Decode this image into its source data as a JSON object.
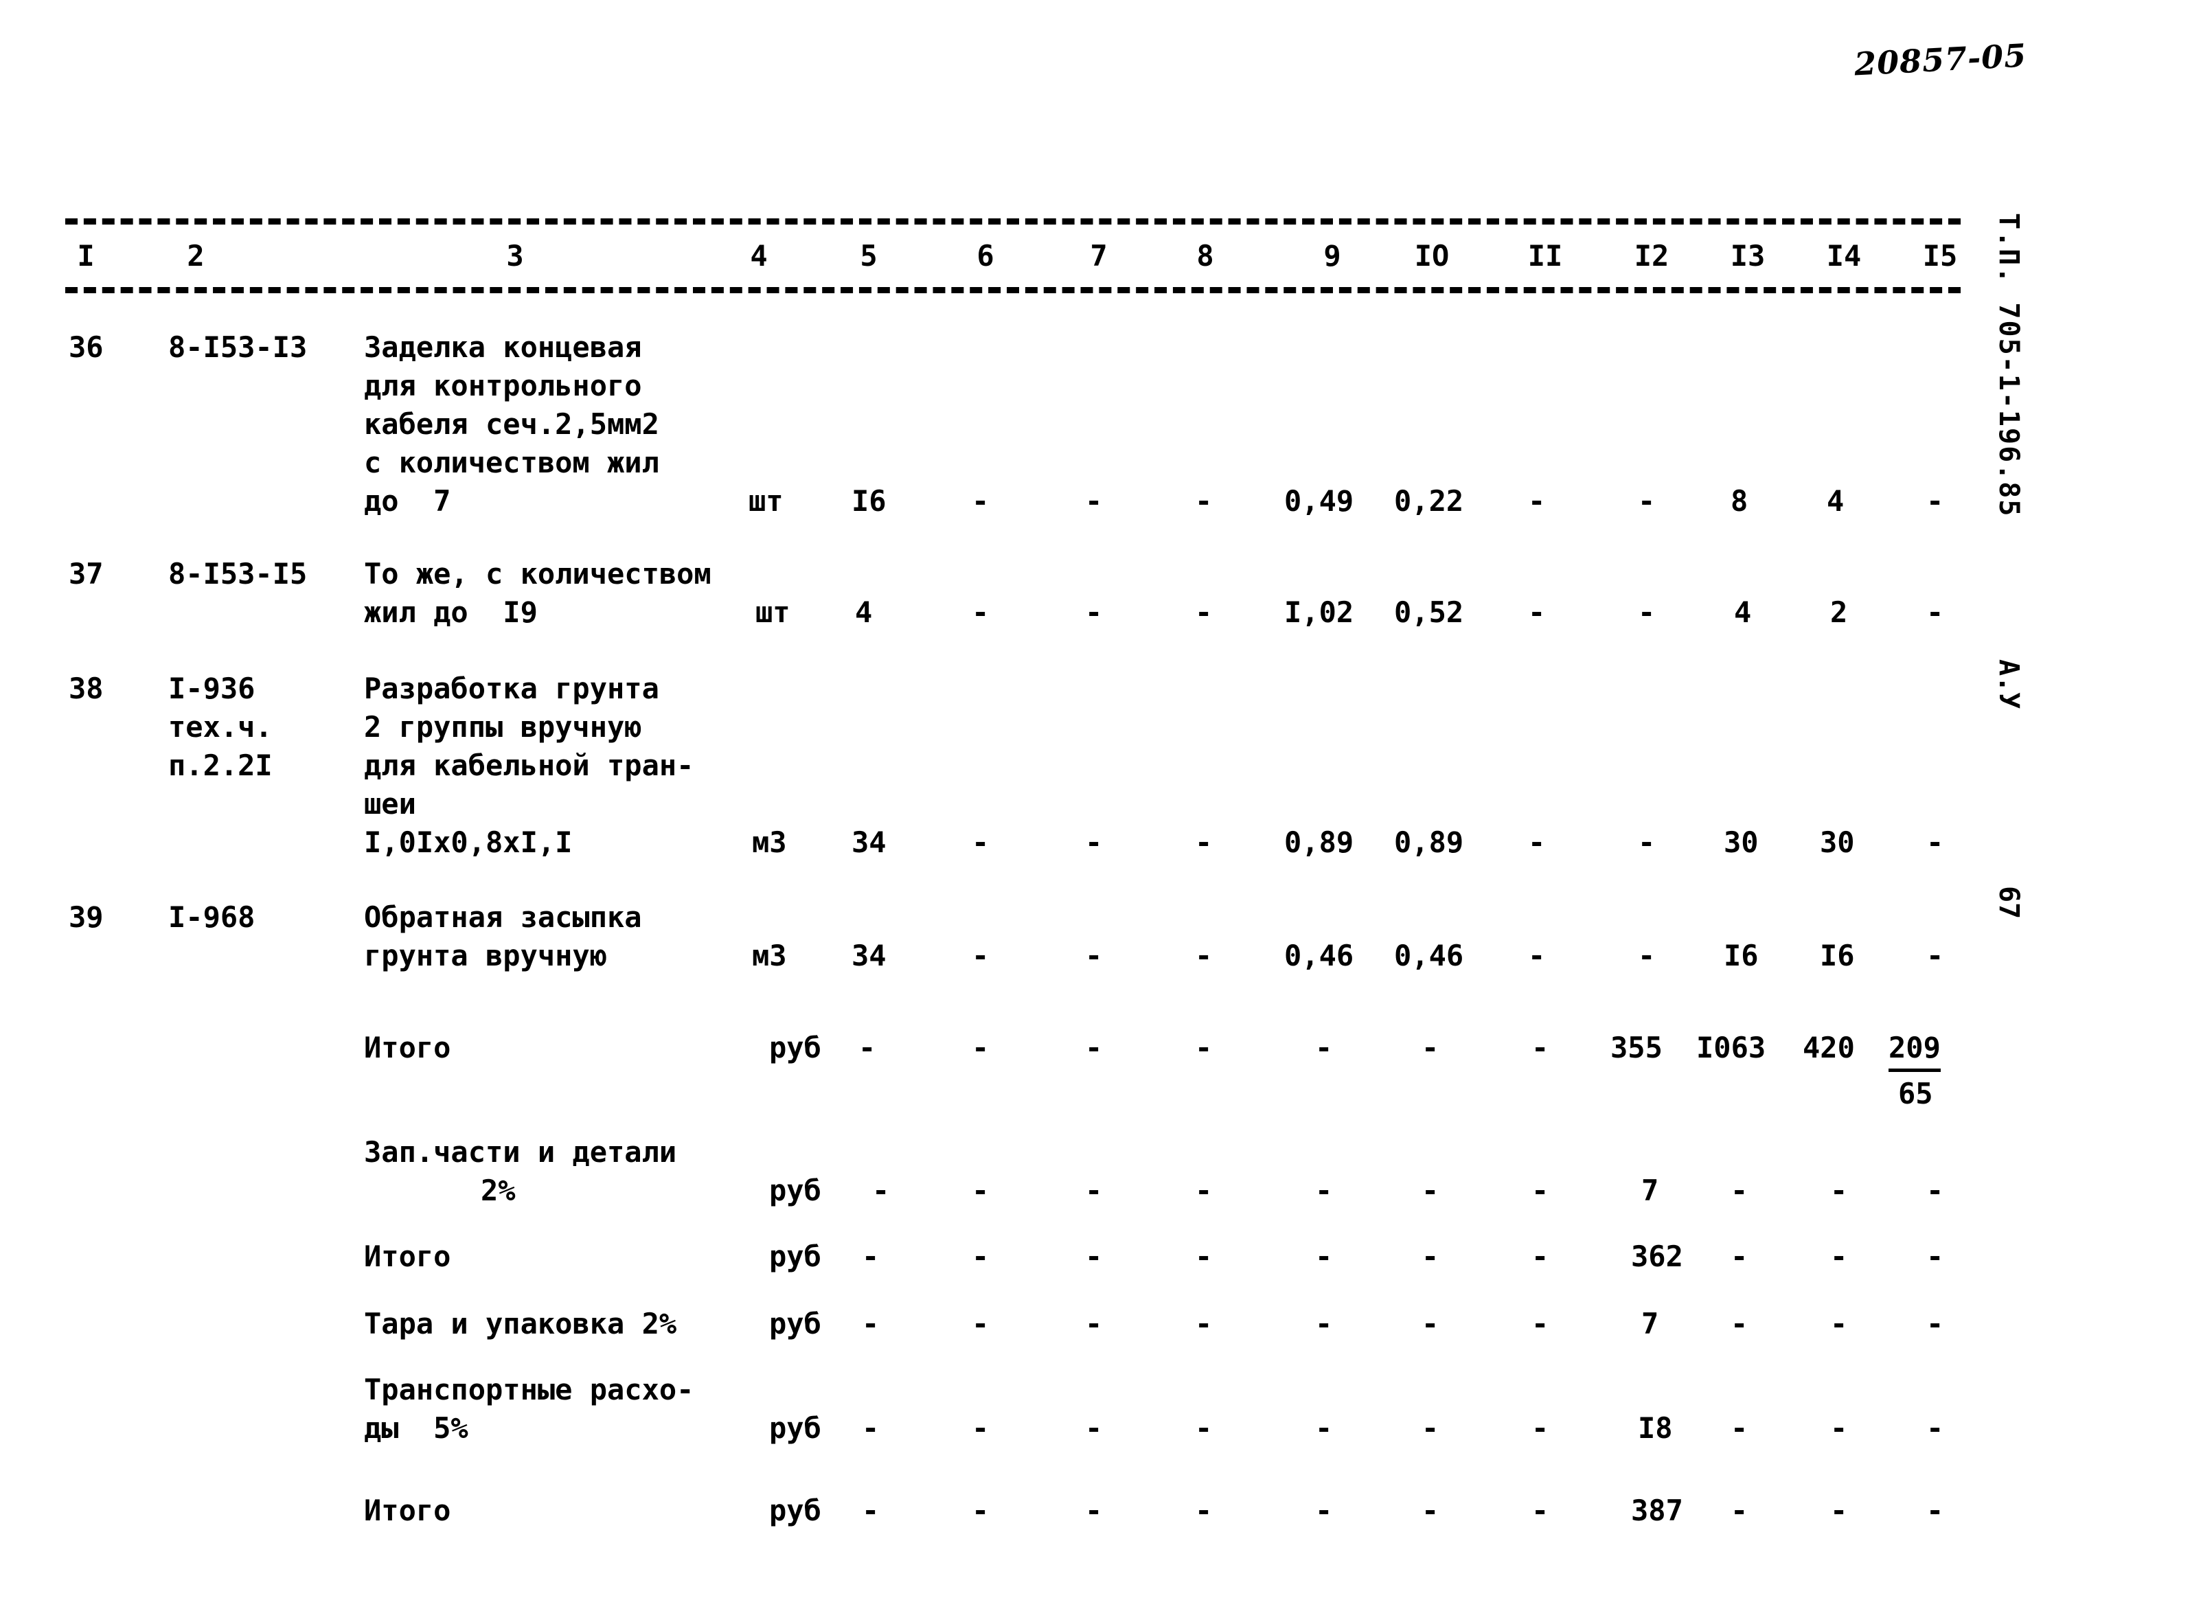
{
  "stamp": "20857-05",
  "vertical": {
    "series_code": "Т.П. 705-1-196.85",
    "sheet_mark": "А.У",
    "page_number": "67"
  },
  "table": {
    "column_headers": [
      "I",
      "2",
      "3",
      "4",
      "5",
      "6",
      "7",
      "8",
      "9",
      "IO",
      "II",
      "I2",
      "I3",
      "I4",
      "I5"
    ],
    "rows": [
      {
        "no": "36",
        "code": "8-I53-I3",
        "description": [
          "Заделка концевая",
          "для контрольного",
          "кабеля сеч.2,5мм2",
          "с количеством жил",
          "до  7"
        ],
        "unit": "шт",
        "qty": "I6",
        "c6": "-",
        "c7": "-",
        "c8": "-",
        "c9": "0,49",
        "c10": "0,22",
        "c11": "-",
        "c12": "-",
        "c13": "8",
        "c14": "4",
        "c15": "-"
      },
      {
        "no": "37",
        "code": "8-I53-I5",
        "description": [
          "То же, с количеством",
          "жил до  I9"
        ],
        "unit": "шт",
        "qty": "4",
        "c6": "-",
        "c7": "-",
        "c8": "-",
        "c9": "I,02",
        "c10": "0,52",
        "c11": "-",
        "c12": "-",
        "c13": "4",
        "c14": "2",
        "c15": "-"
      },
      {
        "no": "38",
        "code": [
          "I-936",
          "тех.ч.",
          "п.2.2I"
        ],
        "description": [
          "Разработка грунта",
          "2 группы вручную",
          "для кабельной тран-",
          "шеи",
          "I,0Iх0,8хI,I"
        ],
        "unit": "м3",
        "qty": "34",
        "c6": "-",
        "c7": "-",
        "c8": "-",
        "c9": "0,89",
        "c10": "0,89",
        "c11": "-",
        "c12": "-",
        "c13": "30",
        "c14": "30",
        "c15": "-"
      },
      {
        "no": "39",
        "code": "I-968",
        "description": [
          "Обратная засыпка",
          "грунта вручную"
        ],
        "unit": "м3",
        "qty": "34",
        "c6": "-",
        "c7": "-",
        "c8": "-",
        "c9": "0,46",
        "c10": "0,46",
        "c11": "-",
        "c12": "-",
        "c13": "I6",
        "c14": "I6",
        "c15": "-"
      }
    ],
    "summary": [
      {
        "label": [
          "Итого"
        ],
        "unit": "руб",
        "c5": "-",
        "c6": "-",
        "c7": "-",
        "c8": "-",
        "c9": "-",
        "c10": "-",
        "c11": "-",
        "c12": "355",
        "c13": "I063",
        "c14": "420",
        "c15_top": "209",
        "c15_bottom": "65"
      },
      {
        "label": [
          "Зап.части и детали",
          "2%"
        ],
        "unit": "руб",
        "c5": "-",
        "c6": "-",
        "c7": "-",
        "c8": "-",
        "c9": "-",
        "c10": "-",
        "c11": "-",
        "c12": "7",
        "c13": "-",
        "c14": "-",
        "c15": "-"
      },
      {
        "label": [
          "Итого"
        ],
        "unit": "руб",
        "c5": "-",
        "c6": "-",
        "c7": "-",
        "c8": "-",
        "c9": "-",
        "c10": "-",
        "c11": "-",
        "c12": "362",
        "c13": "-",
        "c14": "-",
        "c15": "-"
      },
      {
        "label": [
          "Тара и упаковка 2%"
        ],
        "unit": "руб",
        "c5": "-",
        "c6": "-",
        "c7": "-",
        "c8": "-",
        "c9": "-",
        "c10": "-",
        "c11": "-",
        "c12": "7",
        "c13": "-",
        "c14": "-",
        "c15": "-"
      },
      {
        "label": [
          "Транспортные расхо-",
          "ды  5%"
        ],
        "unit": "руб",
        "c5": "-",
        "c6": "-",
        "c7": "-",
        "c8": "-",
        "c9": "-",
        "c10": "-",
        "c11": "-",
        "c12": "I8",
        "c13": "-",
        "c14": "-",
        "c15": "-"
      },
      {
        "label": [
          "Итого"
        ],
        "unit": "руб",
        "c5": "-",
        "c6": "-",
        "c7": "-",
        "c8": "-",
        "c9": "-",
        "c10": "-",
        "c11": "-",
        "c12": "387",
        "c13": "-",
        "c14": "-",
        "c15": "-"
      }
    ]
  }
}
